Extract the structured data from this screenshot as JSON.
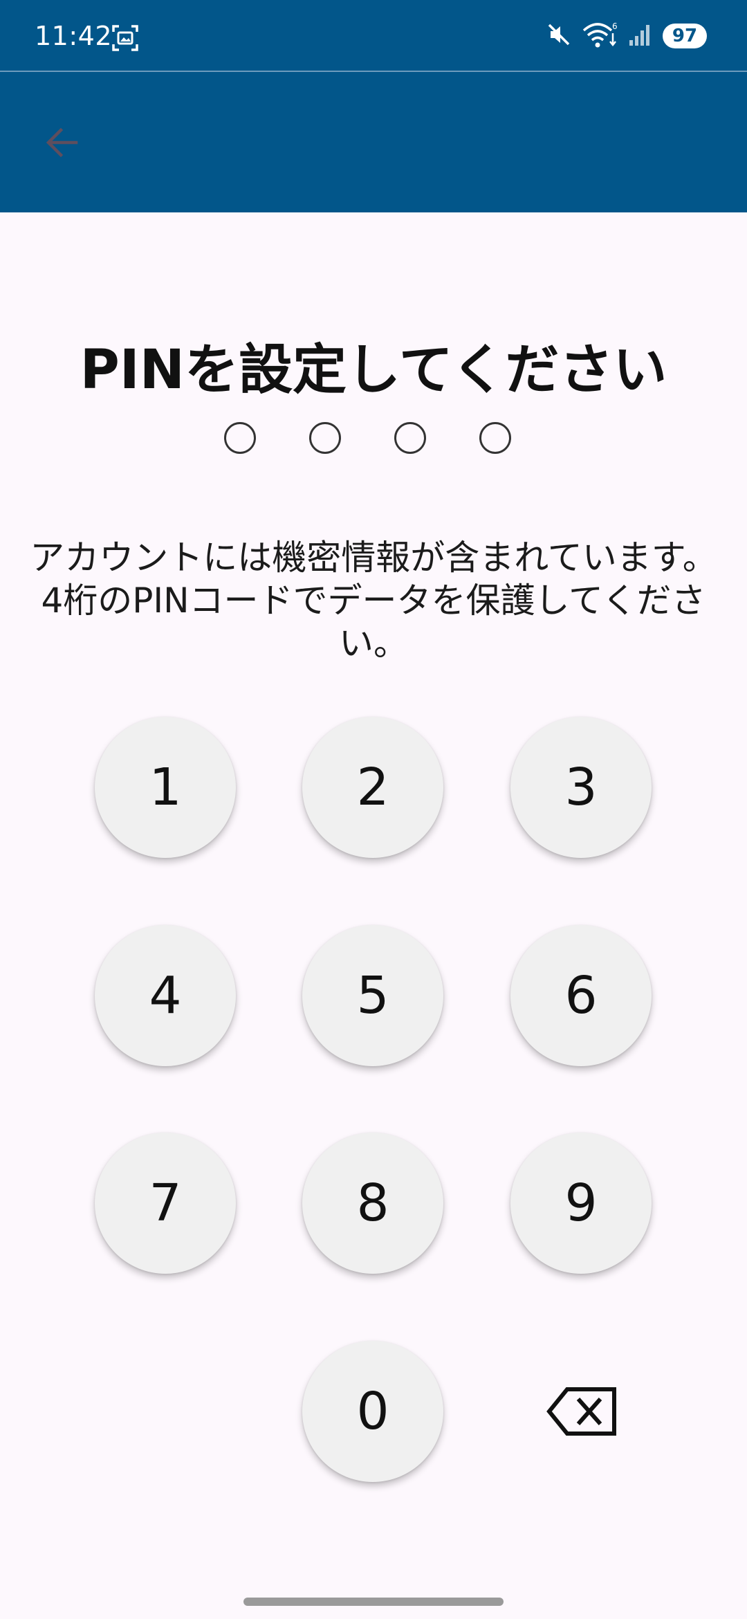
{
  "status_bar": {
    "time": "11:42",
    "battery": "97",
    "icons": [
      "screenshot-icon",
      "mute-icon",
      "wifi-icon",
      "signal-icon"
    ]
  },
  "colors": {
    "primary": "#02568a",
    "background": "#fdf8fd",
    "key_background": "#f0f0f0"
  },
  "app_bar": {
    "back_icon": "arrow-back-icon"
  },
  "title": "PINを設定してください",
  "pin_length": 4,
  "description": "アカウントには機密情報が含まれています。4桁のPINコードでデータを保護してください。",
  "keypad": {
    "keys": [
      "1",
      "2",
      "3",
      "4",
      "5",
      "6",
      "7",
      "8",
      "9",
      "0"
    ],
    "delete_icon": "backspace-icon"
  }
}
